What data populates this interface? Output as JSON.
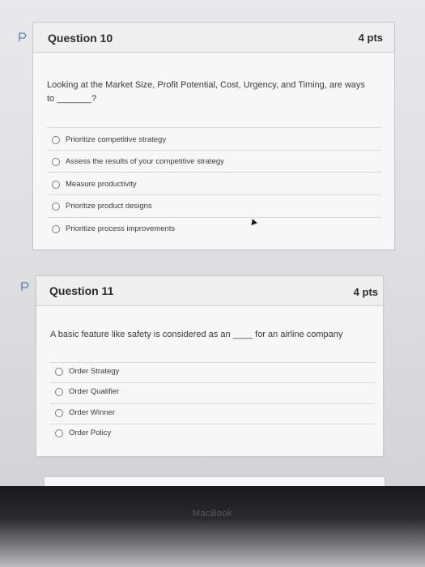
{
  "q10": {
    "title": "Question 10",
    "points": "4 pts",
    "prompt_line1": "Looking at the Market Size, Profit Potential, Cost, Urgency, and Timing, are ways",
    "prompt_line2": "to _______?",
    "options": [
      "Prioritize competitive strategy",
      "Assess the results of your competitive strategy",
      "Measure productivity",
      "Prioritize product designs",
      "Prioritize process improvements"
    ]
  },
  "q11": {
    "title": "Question 11",
    "points": "4 pts",
    "prompt": "A basic feature like safety is considered as an ____ for an airline company",
    "options": [
      "Order Strategy",
      "Order Qualifier",
      "Order Winner",
      "Order Policy"
    ]
  },
  "device": {
    "label": "MacBook"
  },
  "colors": {
    "flag": "#5b7fb8",
    "card_bg": "#f7f7f8"
  }
}
